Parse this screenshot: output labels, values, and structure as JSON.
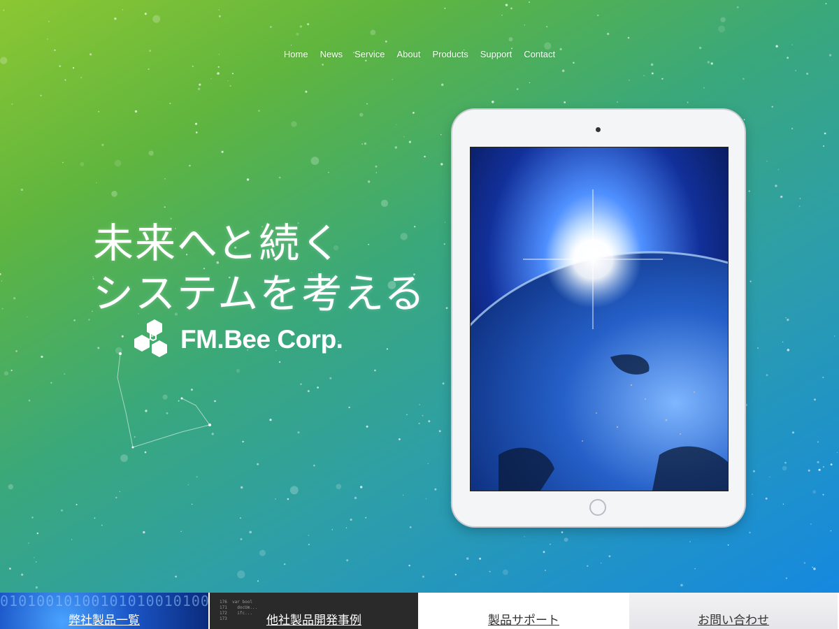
{
  "nav": {
    "items": [
      "Home",
      "News",
      "Service",
      "About",
      "Products",
      "Support",
      "Contact"
    ]
  },
  "hero": {
    "tagline_line1": "未来へと続く",
    "tagline_line2": "システムを考える",
    "logo_text": "FM.Bee Corp."
  },
  "cards": [
    {
      "label": "弊社製品一覧",
      "deco": "010100101001010100101001"
    },
    {
      "label": "他社製品開発事例",
      "deco": "176  var bool\n171    docUm...\n172    ifc...\n173"
    },
    {
      "label": "製品サポート"
    },
    {
      "label": "お問い合わせ"
    }
  ],
  "colors": {
    "gradient_start": "#8cc733",
    "gradient_end": "#1688e0"
  }
}
